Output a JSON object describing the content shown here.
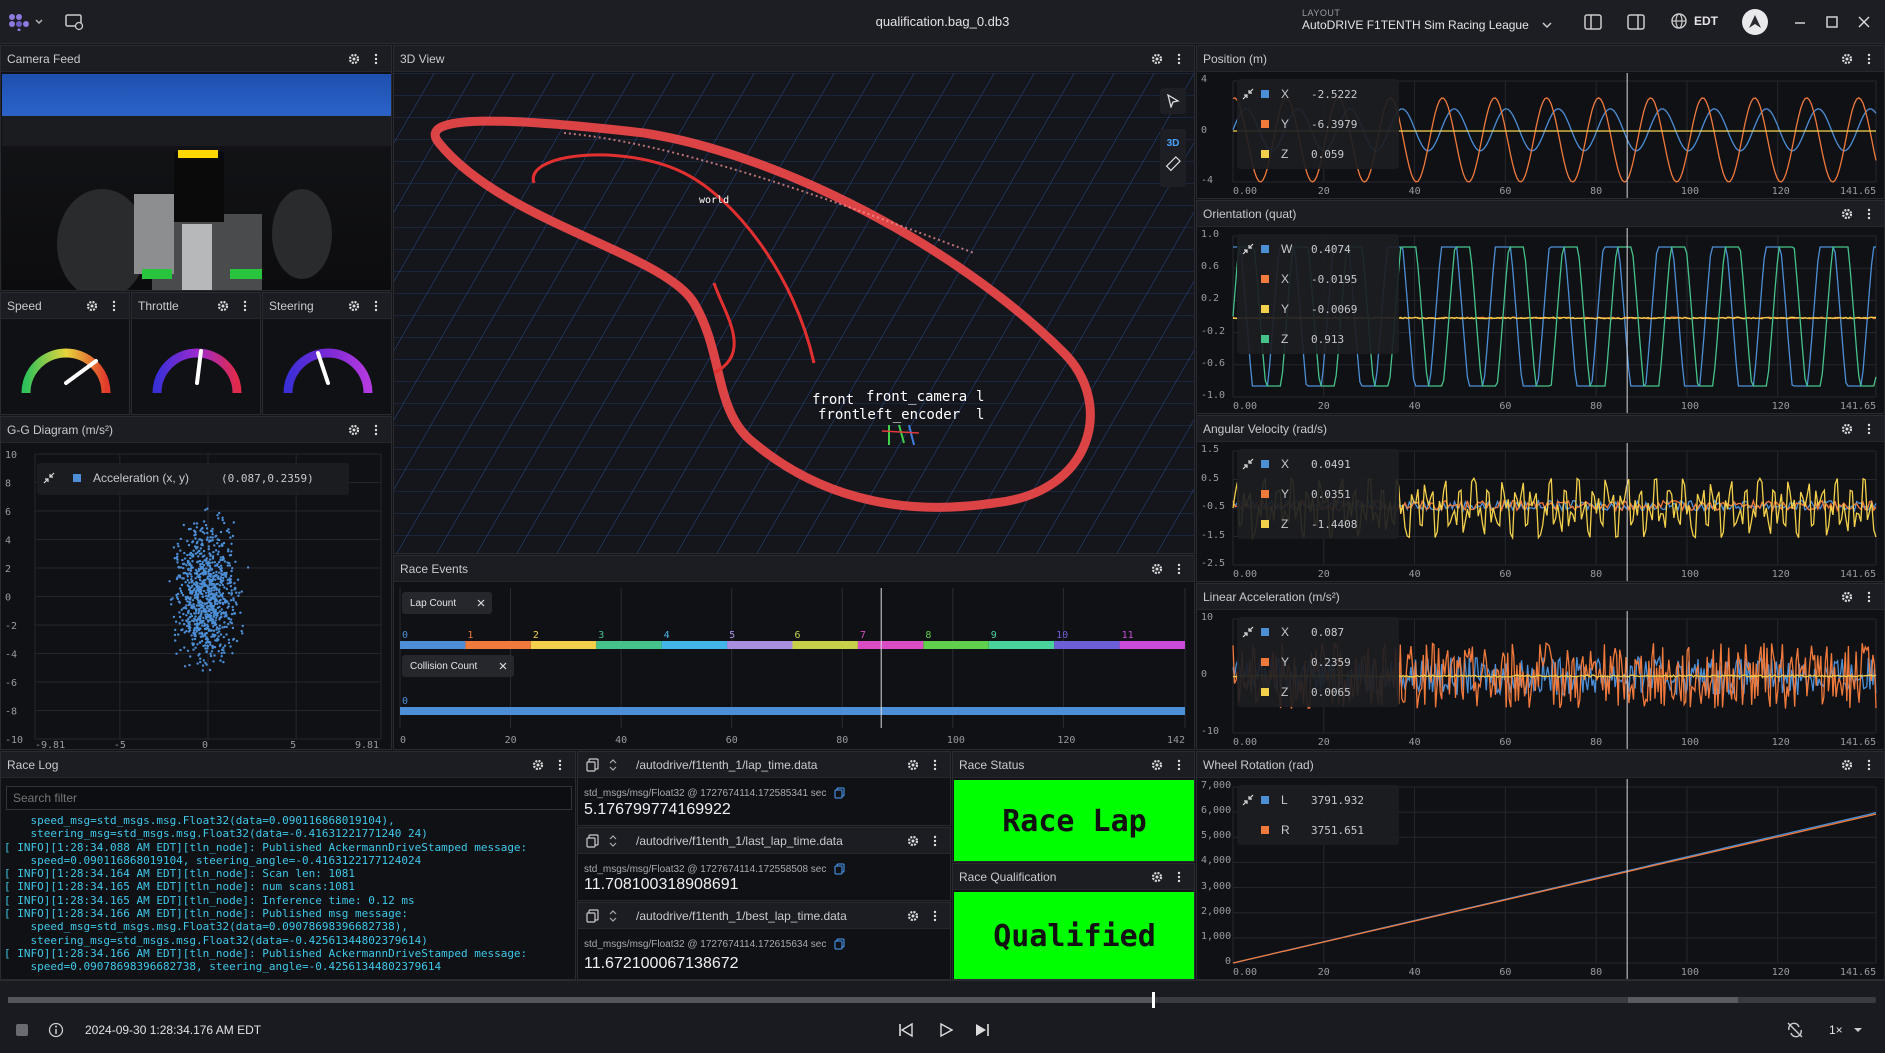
{
  "title": "qualification.bag_0.db3",
  "layout": {
    "caption": "LAYOUT",
    "name": "AutoDRIVE F1TENTH Sim Racing League"
  },
  "timezone": "EDT",
  "panels": {
    "camera": "Camera Feed",
    "view3d": "3D View",
    "speed": "Speed",
    "throttle": "Throttle",
    "steering": "Steering",
    "gg": "G-G Diagram (m/s²)",
    "race_events": "Race Events",
    "race_log": "Race Log",
    "position": "Position (m)",
    "orientation": "Orientation (quat)",
    "angvel": "Angular Velocity (rad/s)",
    "linacc": "Linear Acceleration (m/s²)",
    "wheel": "Wheel Rotation (rad)",
    "race_status": "Race Status",
    "race_qual": "Race Qualification"
  },
  "view3d": {
    "mode_label": "3D",
    "labels": {
      "world": "world",
      "cam": "front_camera",
      "enc": "left_encoder",
      "front1": "front",
      "front2": "front",
      "suffix1": "l",
      "suffix2": "l"
    }
  },
  "gg": {
    "legend_name": "Acceleration (x, y)",
    "legend_value": "(0.087,0.2359)",
    "yticks": [
      "10",
      "8",
      "6",
      "4",
      "2",
      "0",
      "-2",
      "-4",
      "-6",
      "-8",
      "-10"
    ],
    "xticks": [
      "-9.81",
      "-5",
      "0",
      "5",
      "9.81"
    ]
  },
  "race_events": {
    "lap_chip": "Lap Count",
    "collision_chip": "Collision Count",
    "lap_labels": [
      "0",
      "1",
      "2",
      "3",
      "4",
      "5",
      "6",
      "7",
      "8",
      "9",
      "10",
      "11"
    ],
    "collision_label": "0",
    "xticks": [
      "0",
      "20",
      "40",
      "60",
      "80",
      "100",
      "120",
      "142"
    ],
    "lap_colors": [
      "#4c8fd6",
      "#f07a3c",
      "#f2d04b",
      "#45c28a",
      "#43b6e9",
      "#a98ee0",
      "#c6d049",
      "#d94cc4",
      "#5fcf4c",
      "#49d29b",
      "#6a5fd6",
      "#c94cd9"
    ]
  },
  "race_log": {
    "search_placeholder": "Search filter",
    "lines": [
      "    speed_msg=std_msgs.msg.Float32(data=0.090116868019104),",
      "    steering_msg=std_msgs.msg.Float32(data=-0.41631221771240 24)",
      "[ INFO][1:28:34.088 AM EDT][tln_node]: Published AckermannDriveStamped message:",
      "    speed=0.090116868019104, steering_angle=-0.4163122177124024",
      "[ INFO][1:28:34.164 AM EDT][tln_node]: Scan len: 1081",
      "[ INFO][1:28:34.165 AM EDT][tln_node]: num scans:1081",
      "[ INFO][1:28:34.165 AM EDT][tln_node]: Inference time: 0.12 ms",
      "[ INFO][1:28:34.166 AM EDT][tln_node]: Published msg message:",
      "    speed_msg=std_msgs.msg.Float32(data=0.09078698396682738),",
      "    steering_msg=std_msgs.msg.Float32(data=-0.42561344802379614)",
      "[ INFO][1:28:34.166 AM EDT][tln_node]: Published AckermannDriveStamped message:",
      "    speed=0.09078698396682738, steering_angle=-0.42561344802379614"
    ]
  },
  "raw_msgs": [
    {
      "topic": "/autodrive/f1tenth_1/lap_time.data",
      "meta": "std_msgs/msg/Float32 @ 1727674114.172585341 sec",
      "value": "5.176799774169922"
    },
    {
      "topic": "/autodrive/f1tenth_1/last_lap_time.data",
      "meta": "std_msgs/msg/Float32 @ 1727674114.172558508 sec",
      "value": "11.708100318908691"
    },
    {
      "topic": "/autodrive/f1tenth_1/best_lap_time.data",
      "meta": "std_msgs/msg/Float32 @ 1727674114.172615634 sec",
      "value": "11.672100067138672"
    }
  ],
  "race_status": {
    "text": "Race Lap",
    "color": "#00ff00"
  },
  "race_qual": {
    "text": "Qualified",
    "color": "#00ff00"
  },
  "plots": {
    "position": {
      "legend": [
        [
          "X",
          "-2.5222",
          "#4c8fd6"
        ],
        [
          "Y",
          "-6.3979",
          "#f07a3c"
        ],
        [
          "Z",
          "0.059",
          "#f2d04b"
        ]
      ],
      "yticks": [
        "4",
        "0",
        "-4"
      ],
      "xticks": [
        "0.00",
        "20",
        "40",
        "60",
        "80",
        "100",
        "120",
        "141.65"
      ]
    },
    "orientation": {
      "legend": [
        [
          "W",
          "0.4074",
          "#4c8fd6"
        ],
        [
          "X",
          "-0.0195",
          "#f07a3c"
        ],
        [
          "Y",
          "-0.0069",
          "#f2d04b"
        ],
        [
          "Z",
          "0.913",
          "#45c28a"
        ]
      ],
      "yticks": [
        "1.0",
        "0.6",
        "0.2",
        "-0.2",
        "-0.6",
        "-1.0"
      ],
      "xticks": [
        "0.00",
        "20",
        "40",
        "60",
        "80",
        "100",
        "120",
        "141.65"
      ]
    },
    "angvel": {
      "legend": [
        [
          "X",
          "0.0491",
          "#4c8fd6"
        ],
        [
          "Y",
          "0.0351",
          "#f07a3c"
        ],
        [
          "Z",
          "-1.4408",
          "#f2d04b"
        ]
      ],
      "yticks": [
        "1.5",
        "0.5",
        "-0.5",
        "-1.5",
        "-2.5"
      ],
      "xticks": [
        "0.00",
        "20",
        "40",
        "60",
        "80",
        "100",
        "120",
        "141.65"
      ]
    },
    "linacc": {
      "legend": [
        [
          "X",
          "0.087",
          "#4c8fd6"
        ],
        [
          "Y",
          "0.2359",
          "#f07a3c"
        ],
        [
          "Z",
          "0.0065",
          "#f2d04b"
        ]
      ],
      "yticks": [
        "10",
        "0",
        "-10"
      ],
      "xticks": [
        "0.00",
        "20",
        "40",
        "60",
        "80",
        "100",
        "120",
        "141.65"
      ]
    },
    "wheel": {
      "legend": [
        [
          "L",
          "3791.932",
          "#4c8fd6"
        ],
        [
          "R",
          "3751.651",
          "#f07a3c"
        ]
      ],
      "yticks": [
        "7,000",
        "6,000",
        "5,000",
        "4,000",
        "3,000",
        "2,000",
        "1,000",
        "0"
      ],
      "xticks": [
        "0.00",
        "20",
        "40",
        "60",
        "80",
        "100",
        "120",
        "141.65"
      ]
    }
  },
  "playback": {
    "timestamp": "2024-09-30 1:28:34.176 AM EDT",
    "speed": "1×",
    "progress": 0.613
  }
}
